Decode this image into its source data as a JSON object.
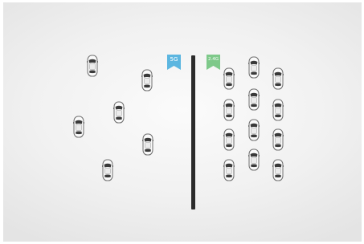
{
  "band_5g": {
    "label": "5G",
    "color": "#5cb6e0"
  },
  "band_24g": {
    "label": "2.4G",
    "color": "#7ec98a"
  },
  "car_icon": "car-icon",
  "divider_icon": "divider-wall"
}
